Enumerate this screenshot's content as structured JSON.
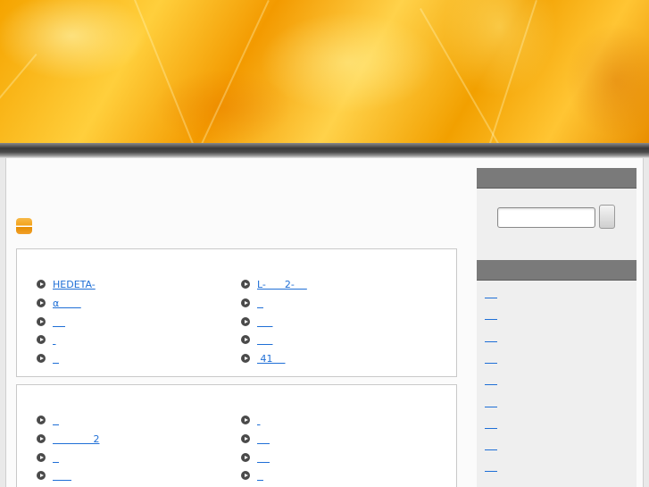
{
  "main": {
    "box1": {
      "left": [
        "HEDETA-",
        "α       ",
        "    ",
        " ",
        "  "
      ],
      "right": [
        "L-      2-    ",
        "  ",
        "     ",
        "     ",
        " 41    "
      ]
    },
    "box2": {
      "left": [
        "  ",
        "             2",
        "  ",
        "      "
      ],
      "right": [
        " ",
        "    ",
        "    ",
        "  "
      ]
    }
  },
  "sidebar": {
    "search": {
      "value": "",
      "button_label": ""
    },
    "links": [
      "    ",
      "    ",
      "    ",
      "    ",
      "    ",
      "    ",
      "    ",
      "    ",
      "    "
    ]
  }
}
